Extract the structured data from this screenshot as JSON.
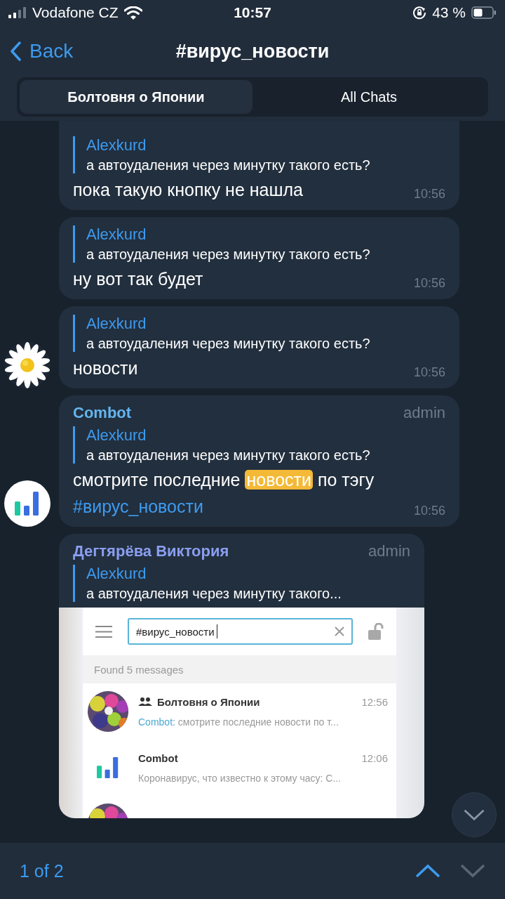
{
  "status_bar": {
    "carrier": "Vodafone CZ",
    "time": "10:57",
    "battery": "43 %"
  },
  "nav": {
    "back": "Back",
    "title": "#вирус_новости"
  },
  "tabs": [
    {
      "label": "Болтовня о Японии",
      "selected": true
    },
    {
      "label": "All Chats",
      "selected": false
    }
  ],
  "messages": [
    {
      "reply": {
        "author": "Alexkurd",
        "text": "а автоудаления через минутку такого есть?"
      },
      "body": [
        {
          "kind": "plain",
          "text": "пока такую кнопку не нашла"
        }
      ],
      "time": "10:56"
    },
    {
      "reply": {
        "author": "Alexkurd",
        "text": "а автоудаления через минутку такого есть?"
      },
      "body": [
        {
          "kind": "plain",
          "text": "ну вот так будет"
        }
      ],
      "time": "10:56"
    },
    {
      "avatar": {
        "kind": "picture"
      },
      "reply": {
        "author": "Alexkurd",
        "text": "а автоудаления через минутку такого есть?"
      },
      "body": [
        {
          "kind": "plain",
          "text": "новости"
        }
      ],
      "time": "10:56"
    },
    {
      "avatar": {
        "kind": "bot"
      },
      "sender": "Combot",
      "color": "#64b5f0",
      "role": "admin",
      "reply": {
        "author": "Alexkurd",
        "text": "а автоудаления через минутку такого есть?"
      },
      "body": [
        {
          "kind": "plain",
          "text": "смотрите последние "
        },
        {
          "kind": "highlight",
          "text": "новости"
        },
        {
          "kind": "plain",
          "text": " по тэгу"
        },
        {
          "kind": "hashtag",
          "text": "#вирус_новости"
        }
      ],
      "time": "10:56"
    },
    {
      "sender": "Дегтярёва Виктория",
      "color": "#8a9ef0",
      "role": "admin",
      "reply": {
        "author": "Alexkurd",
        "text": "а автоудаления через минутку такого..."
      },
      "image": {
        "search": "#вирус_новости",
        "found": "Found 5 messages",
        "results": [
          {
            "avatar": {
              "kind": "picture"
            },
            "group": true,
            "name": "Болтовня о Японии",
            "time": "12:56",
            "from": "Combot:",
            "preview": "смотрите последние новости по т..."
          },
          {
            "avatar": {
              "kind": "bot"
            },
            "group": false,
            "name": "Combot",
            "time": "12:06",
            "preview": "Коронавирус, что известно к этому часу: С..."
          }
        ]
      }
    }
  ],
  "search_bar": {
    "counter": "1 of 2",
    "up_enabled": true,
    "down_enabled": false
  }
}
